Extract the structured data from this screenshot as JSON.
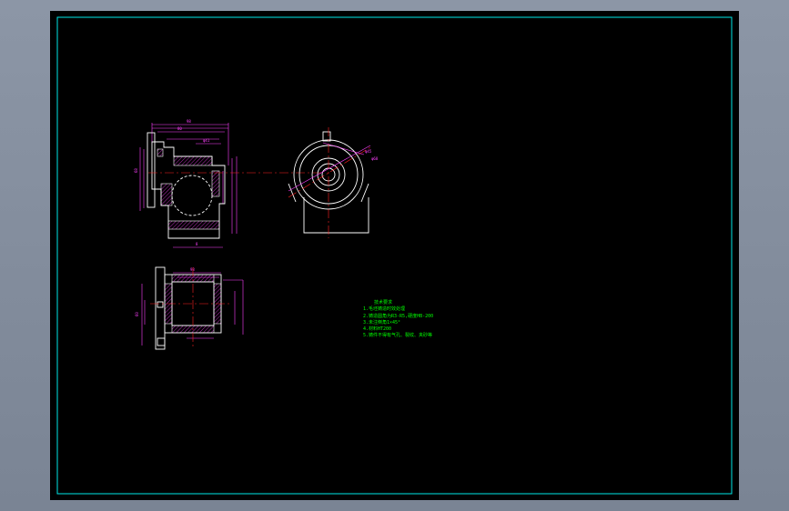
{
  "viewer": {
    "background": "#8a94a4",
    "paper": "#000000",
    "frame_color": "#00e6e6"
  },
  "colors": {
    "outline": "#ffffff",
    "dimension": "#ff40ff",
    "centerline": "#ff2020",
    "notes": "#00ff00",
    "hatch": "#ff40ff"
  },
  "notes": {
    "title": "技术要求",
    "lines": [
      "1.毛坯铸造时效处理",
      "2.铸造圆角为R3-R5,硬度HB-200",
      "3.未注倒角1×45°",
      "4.材料HT200",
      "5.铸件不得有气孔、裂纹、夹砂等"
    ]
  },
  "views": {
    "front_section": "front-section-view",
    "side_view": "side-view",
    "top_section": "top-section-view"
  }
}
